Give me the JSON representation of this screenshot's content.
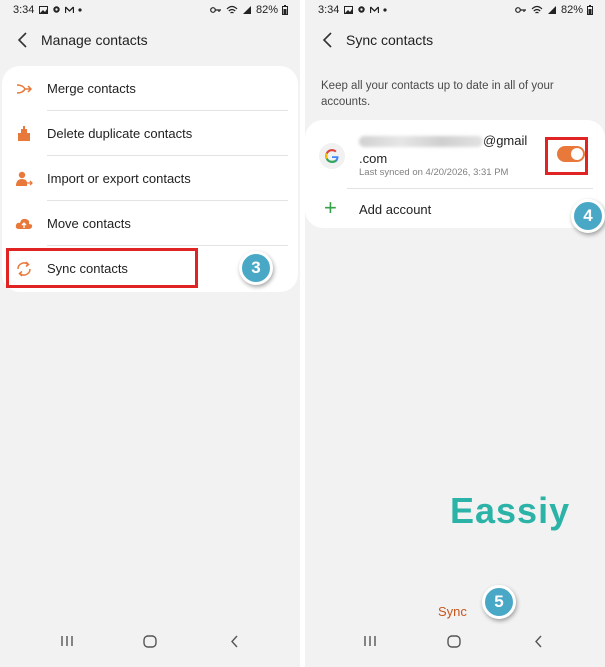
{
  "left_screen": {
    "status": {
      "time": "3:34",
      "battery": "82%"
    },
    "header": {
      "title": "Manage contacts"
    },
    "menu": [
      {
        "label": "Merge contacts",
        "icon": "merge-icon"
      },
      {
        "label": "Delete duplicate contacts",
        "icon": "delete-duplicate-icon"
      },
      {
        "label": "Import or export contacts",
        "icon": "import-export-icon"
      },
      {
        "label": "Move contacts",
        "icon": "cloud-upload-icon"
      },
      {
        "label": "Sync contacts",
        "icon": "sync-icon"
      }
    ],
    "step_badge": "3"
  },
  "right_screen": {
    "status": {
      "time": "3:34",
      "battery": "82%"
    },
    "header": {
      "title": "Sync contacts"
    },
    "description": "Keep all your contacts up to date in all of your accounts.",
    "account": {
      "email_suffix": "@gmail",
      "email_domain": ".com",
      "last_synced": "Last synced on 4/20/2026, 3:31 PM",
      "sync_enabled": true
    },
    "add_account_label": "Add account",
    "step_badge_toggle": "4",
    "step_badge_sync": "5",
    "sync_button_label": "Sync",
    "watermark": "Eassiy"
  },
  "colors": {
    "accent": "#e8793a",
    "highlight": "#e02424",
    "badge": "#4aa8c7",
    "add_icon": "#37a14a",
    "watermark": "#2bb3a7"
  }
}
